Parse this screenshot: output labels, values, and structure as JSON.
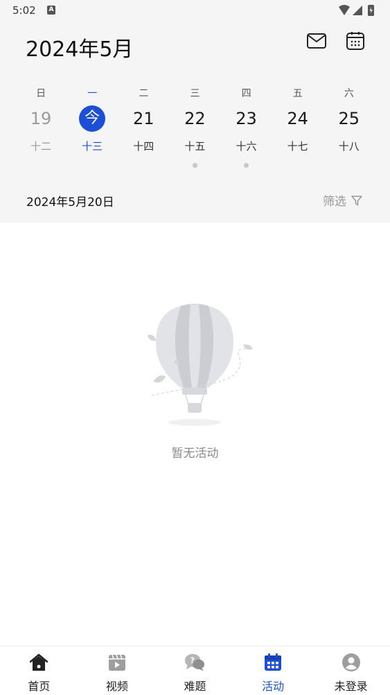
{
  "status": {
    "time": "5:02"
  },
  "header": {
    "month_title": "2024年5月"
  },
  "weekdays": [
    "日",
    "一",
    "二",
    "三",
    "四",
    "五",
    "六"
  ],
  "days": [
    {
      "num": "19",
      "lunar": "十二"
    },
    {
      "num": "今",
      "lunar": "十三"
    },
    {
      "num": "21",
      "lunar": "十四"
    },
    {
      "num": "22",
      "lunar": "十五"
    },
    {
      "num": "23",
      "lunar": "十六"
    },
    {
      "num": "24",
      "lunar": "十七"
    },
    {
      "num": "25",
      "lunar": "十八"
    }
  ],
  "selected_date": "2024年5月20日",
  "filter_label": "筛选",
  "empty_text": "暂无活动",
  "tabs": [
    {
      "label": "首页",
      "icon": "home-icon"
    },
    {
      "label": "视频",
      "icon": "video-icon"
    },
    {
      "label": "难题",
      "icon": "question-chat-icon"
    },
    {
      "label": "活动",
      "icon": "calendar-icon"
    },
    {
      "label": "未登录",
      "icon": "user-icon"
    }
  ],
  "colors": {
    "accent": "#1a4fd6",
    "header_bg": "#f5f5f5",
    "muted": "#9a9a9a"
  }
}
